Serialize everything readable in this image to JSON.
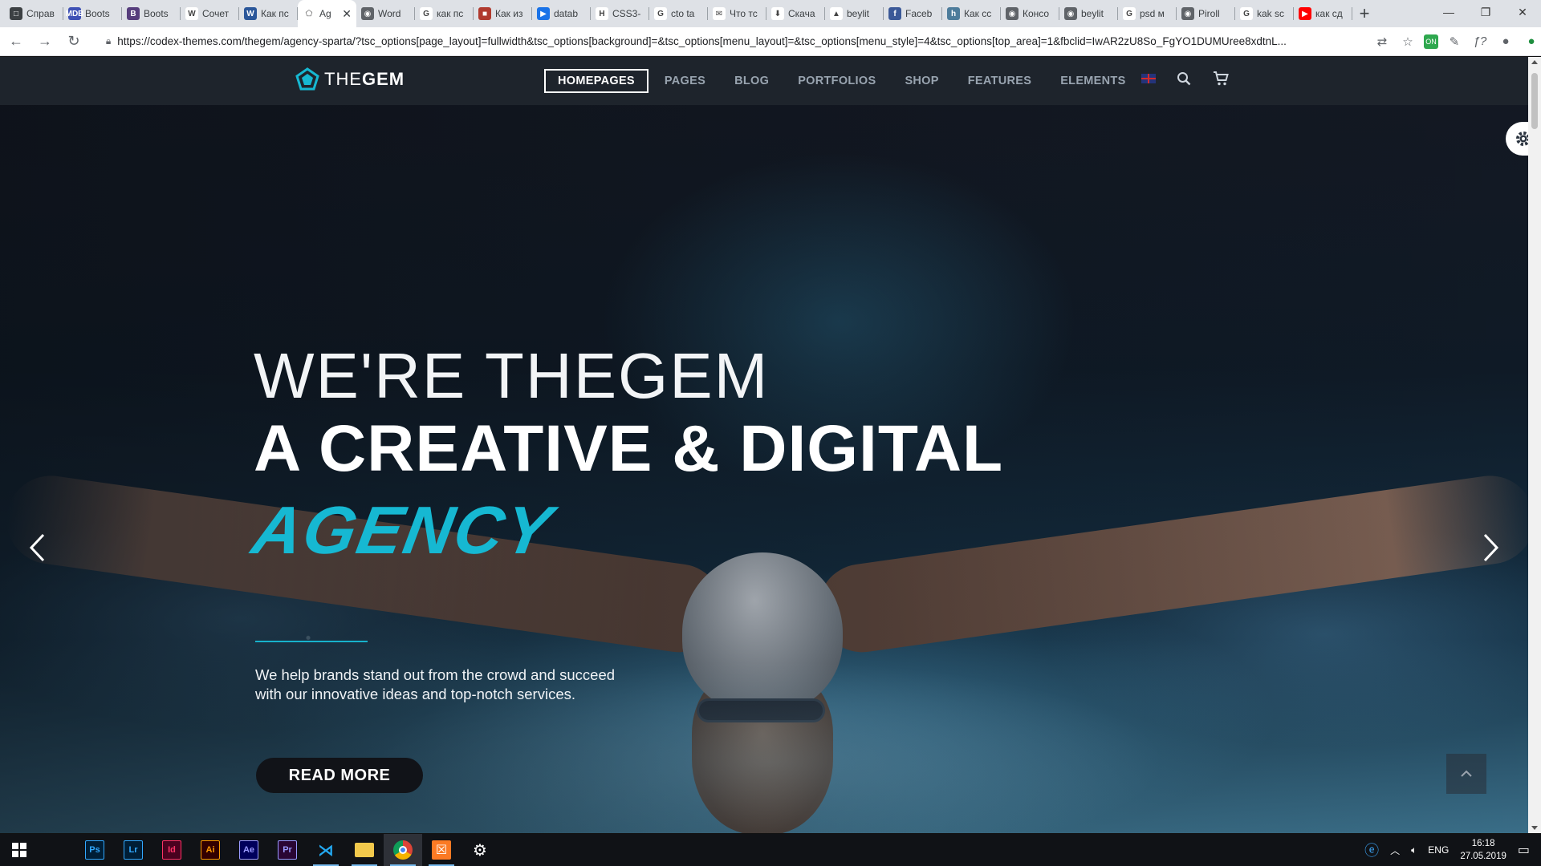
{
  "browser": {
    "tabs": [
      {
        "label": "Справ",
        "icon": "chat-icon",
        "fav_color": "#3c4043",
        "fav_text": "□"
      },
      {
        "label": "Boots",
        "icon": "mdb-icon",
        "fav_color": "#3f51b5",
        "fav_text": "MDB"
      },
      {
        "label": "Boots",
        "icon": "bootstrap-icon",
        "fav_color": "#563d7c",
        "fav_text": "B"
      },
      {
        "label": "Сочет",
        "icon": "wikipedia-icon",
        "fav_color": "#ffffff",
        "fav_text": "W"
      },
      {
        "label": "Как пс",
        "icon": "word-icon",
        "fav_color": "#2b579a",
        "fav_text": "W"
      },
      {
        "label": "Ag",
        "icon": "thegem-icon",
        "fav_color": "#ffffff",
        "fav_text": "⬠",
        "active": true
      },
      {
        "label": "Word",
        "icon": "globe-icon",
        "fav_color": "#5f6368",
        "fav_text": "◉"
      },
      {
        "label": "как пс",
        "icon": "google-icon",
        "fav_color": "#ffffff",
        "fav_text": "G"
      },
      {
        "label": "Как из",
        "icon": "site-icon",
        "fav_color": "#b03a2e",
        "fav_text": "■"
      },
      {
        "label": "datab",
        "icon": "flag-icon",
        "fav_color": "#1a73e8",
        "fav_text": "▶"
      },
      {
        "label": "CSS3-",
        "icon": "html-icon",
        "fav_color": "#ffffff",
        "fav_text": "H"
      },
      {
        "label": "cto ta",
        "icon": "google-icon",
        "fav_color": "#ffffff",
        "fav_text": "G"
      },
      {
        "label": "Что тс",
        "icon": "mail-icon",
        "fav_color": "#ffffff",
        "fav_text": "✉"
      },
      {
        "label": "Скача",
        "icon": "download-icon",
        "fav_color": "#ffffff",
        "fav_text": "⬇"
      },
      {
        "label": "beylit",
        "icon": "chart-icon",
        "fav_color": "#ffffff",
        "fav_text": "▲"
      },
      {
        "label": "Faceb",
        "icon": "facebook-icon",
        "fav_color": "#3b5998",
        "fav_text": "f"
      },
      {
        "label": "Как сс",
        "icon": "habr-icon",
        "fav_color": "#4d7c9b",
        "fav_text": "h"
      },
      {
        "label": "Консо",
        "icon": "globe-icon",
        "fav_color": "#5f6368",
        "fav_text": "◉"
      },
      {
        "label": "beylit",
        "icon": "globe-icon",
        "fav_color": "#5f6368",
        "fav_text": "◉"
      },
      {
        "label": "psd м",
        "icon": "google-icon",
        "fav_color": "#ffffff",
        "fav_text": "G"
      },
      {
        "label": "Piroll",
        "icon": "globe-icon",
        "fav_color": "#5f6368",
        "fav_text": "◉"
      },
      {
        "label": "kak sc",
        "icon": "google-icon",
        "fav_color": "#ffffff",
        "fav_text": "G"
      },
      {
        "label": "как сд",
        "icon": "youtube-icon",
        "fav_color": "#ff0000",
        "fav_text": "▶"
      }
    ],
    "url": "https://codex-themes.com/thegem/agency-sparta/?tsc_options[page_layout]=fullwidth&tsc_options[background]=&tsc_options[menu_layout]=&tsc_options[menu_style]=4&tsc_options[top_area]=1&fbclid=IwAR2zU8So_FgYO1DUMUree8xdtnL..."
  },
  "site": {
    "logo_light": "THE",
    "logo_bold": "GEM",
    "nav": [
      "HOMEPAGES",
      "PAGES",
      "BLOG",
      "PORTFOLIOS",
      "SHOP",
      "FEATURES",
      "ELEMENTS"
    ],
    "accent_color": "#16b8d2"
  },
  "hero": {
    "line1": "WE'RE THEGEM",
    "line2": "A CREATIVE & DIGITAL",
    "line3": "AGENCY",
    "text_line1": "We help brands stand out from the crowd and succeed",
    "text_line2": "with our innovative ideas and top-notch services.",
    "cta": "READ MORE"
  },
  "taskbar": {
    "apps": [
      {
        "label": "Ps",
        "icon": "photoshop-icon",
        "color": "#31a8ff",
        "bg": "#001e36"
      },
      {
        "label": "Lr",
        "icon": "lightroom-icon",
        "color": "#31a8ff",
        "bg": "#001e36"
      },
      {
        "label": "Id",
        "icon": "indesign-icon",
        "color": "#ff3366",
        "bg": "#49021f"
      },
      {
        "label": "Ai",
        "icon": "illustrator-icon",
        "color": "#ff9a00",
        "bg": "#330000"
      },
      {
        "label": "Ae",
        "icon": "aftereffects-icon",
        "color": "#9999ff",
        "bg": "#00005b"
      },
      {
        "label": "Pr",
        "icon": "premiere-icon",
        "color": "#9999ff",
        "bg": "#2a0634"
      },
      {
        "label": "",
        "icon": "vscode-icon",
        "color": "#23a9f2",
        "bg": "#101216"
      },
      {
        "label": "",
        "icon": "file-explorer-icon",
        "color": "#f2c94c",
        "bg": "#101216"
      },
      {
        "label": "",
        "icon": "chrome-icon",
        "color": "#4caf50",
        "bg": "#101216"
      },
      {
        "label": "",
        "icon": "xampp-icon",
        "color": "#fb7a24",
        "bg": "#101216"
      },
      {
        "label": "",
        "icon": "settings-icon",
        "color": "#ffffff",
        "bg": "#101216"
      }
    ],
    "language": "ENG",
    "time": "16:18",
    "date": "27.05.2019"
  }
}
